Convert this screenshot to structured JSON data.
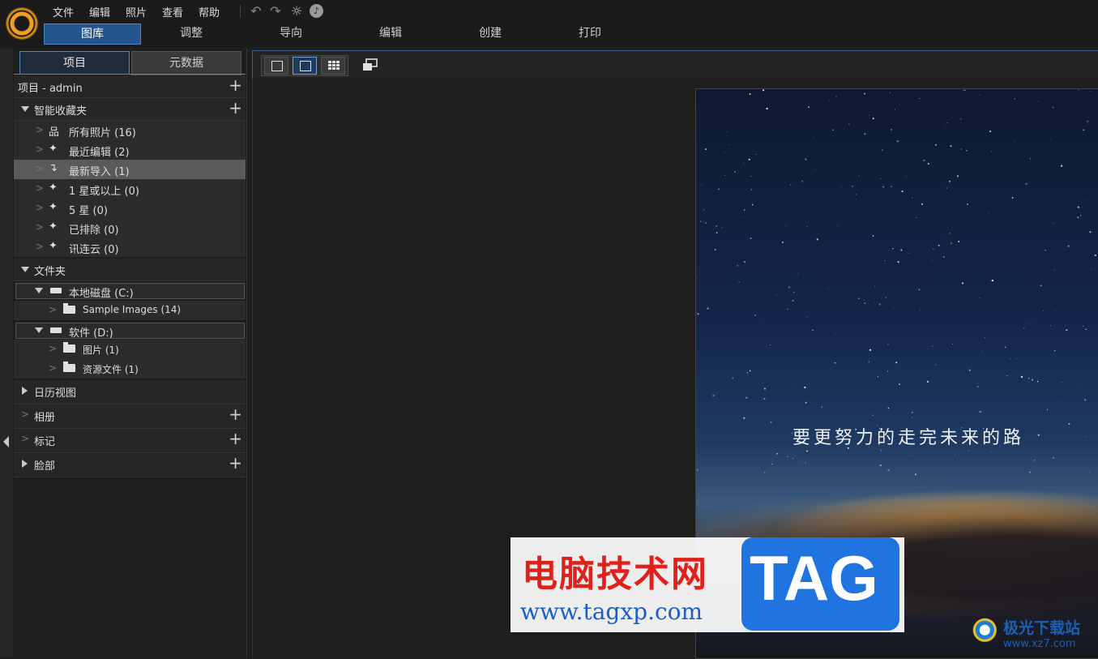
{
  "menu": [
    "文件",
    "编辑",
    "照片",
    "查看",
    "帮助"
  ],
  "mode_tabs": [
    "图库",
    "调整",
    "导向",
    "编辑",
    "创建",
    "打印"
  ],
  "panel_tabs": [
    "项目",
    "元数据"
  ],
  "project_header": "项目 - admin",
  "smart_collections": {
    "title": "智能收藏夹",
    "items": [
      "所有照片 (16)",
      "最近编辑 (2)",
      "最新导入 (1)",
      "1 星或以上 (0)",
      "5 星 (0)",
      "已排除 (0)",
      "讯连云 (0)"
    ]
  },
  "folders": {
    "title": "文件夹",
    "drive_c": "本地磁盘 (C:)",
    "drive_c_items": [
      "Sample Images (14)"
    ],
    "drive_d": "软件 (D:)",
    "drive_d_items": [
      "图片 (1)",
      "资源文件 (1)"
    ]
  },
  "sections": [
    "日历视图",
    "相册",
    "标记",
    "脸部"
  ],
  "photo": {
    "caption": "要更努力的走完未来的路"
  },
  "watermark": {
    "site_name": "电脑技术网",
    "site_url": "www.tagxp.com",
    "tag": "TAG",
    "site2_name": "极光下载站",
    "site2_url": "www.xz7.com"
  },
  "icons": [
    "app-logo-icon",
    "undo-icon",
    "redo-icon",
    "settings-icon",
    "notification-icon",
    "compare-icon"
  ],
  "colors": {
    "accent": "#24558c",
    "selected_row": "#5a5a5a"
  }
}
